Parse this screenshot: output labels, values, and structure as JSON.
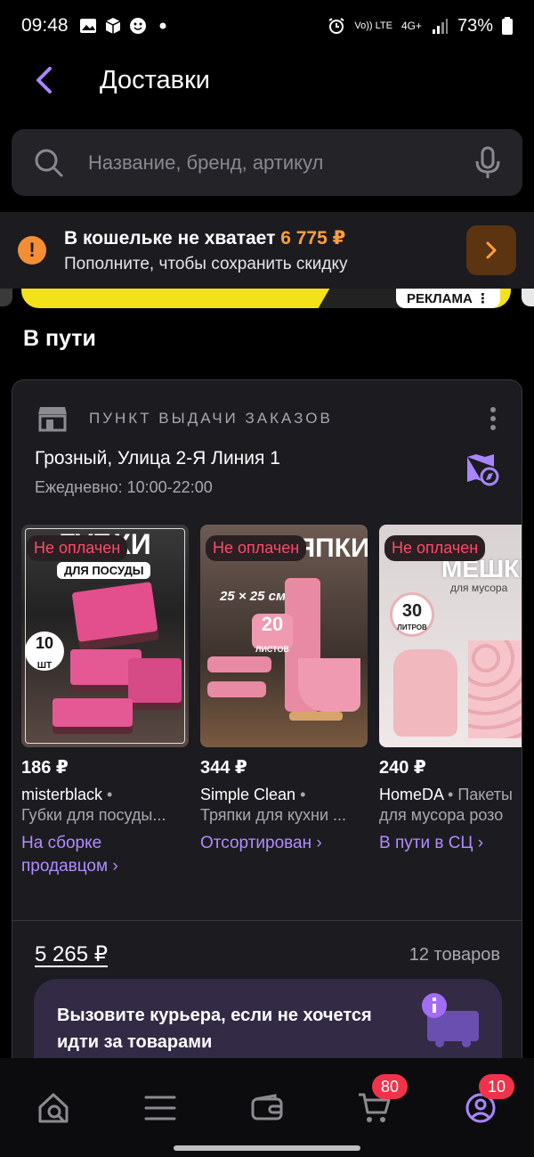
{
  "status_bar": {
    "time": "09:48",
    "battery": "73%",
    "network_1": "Vo)) LTE",
    "network_2": "4G+"
  },
  "header": {
    "title": "Доставки"
  },
  "search": {
    "placeholder": "Название, бренд, артикул"
  },
  "wallet_banner": {
    "title": "В кошельке не хватает",
    "amount": "6 775 ₽",
    "subtitle": "Пополните, чтобы сохранить скидку"
  },
  "ad": {
    "label": "РЕКЛАМА"
  },
  "section": {
    "title": "В пути"
  },
  "pickup": {
    "label": "ПУНКТ ВЫДАЧИ ЗАКАЗОВ",
    "address": "Грозный, Улица 2-Я Линия 1",
    "hours": "Ежедневно: 10:00-22:00"
  },
  "products": [
    {
      "badge": "Не оплачен",
      "price": "186 ₽",
      "brand": "misterblack",
      "desc": "Губки для посуды...",
      "status": "На сборке продавцом ›",
      "image_text": "ГУБКИ",
      "image_sub": "ДЛЯ ПОСУДЫ",
      "image_count": "10",
      "image_unit": "ШТ"
    },
    {
      "badge": "Не оплачен",
      "price": "344 ₽",
      "brand": "Simple Clean",
      "desc": "Тряпки для кухни ...",
      "status": "Отсортирован ›",
      "image_text": "ТРЯПКИ",
      "image_sub": "25 × 25 см",
      "image_count": "20",
      "image_unit": "ЛИСТОВ"
    },
    {
      "badge": "Не оплачен",
      "price": "240 ₽",
      "brand": "HomeDA",
      "desc": "для мусора розо",
      "desc_extra": "Пакеты",
      "status": "В пути в СЦ ›",
      "image_text": "МЕШКИ",
      "image_sub": "для мусора",
      "image_count": "30",
      "image_unit": "ЛИТРОВ"
    }
  ],
  "order": {
    "total": "5 265 ₽",
    "count": "12 товаров"
  },
  "courier": {
    "text": "Вызовите курьера, если не хочется идти за товарами"
  },
  "nav": {
    "cart_badge": "80",
    "profile_badge": "10"
  },
  "colors": {
    "accent": "#b18cff",
    "warning": "#f38e35",
    "error": "#ff4a6a",
    "background": "#000000",
    "card": "#1c1b20"
  }
}
